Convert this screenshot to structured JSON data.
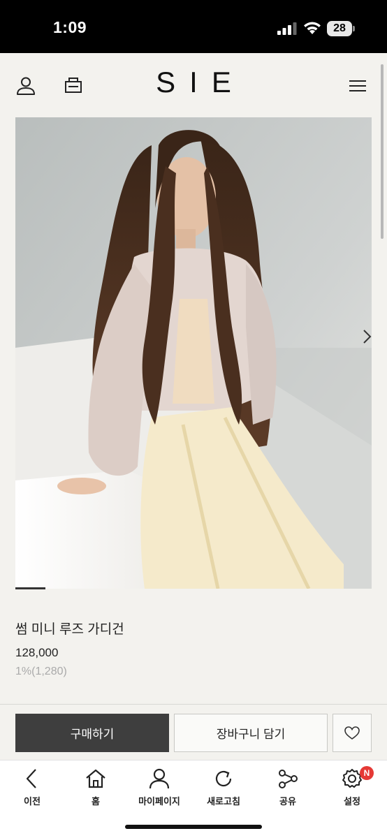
{
  "status_bar": {
    "time": "1:09",
    "battery": "28",
    "icons": [
      "cellular-signal-icon",
      "wifi-icon",
      "battery-icon"
    ]
  },
  "header": {
    "logo": "SIE",
    "icons": [
      "user-icon",
      "shop-icon",
      "menu-icon"
    ]
  },
  "product": {
    "image_alt": "model wearing sheer pink cardigan and cream skirt",
    "image_page": 1,
    "image_count": 12,
    "name": "썸 미니 루즈 가디건",
    "price": "128,000",
    "point": "1%(1,280)"
  },
  "actions": {
    "buy_label": "구매하기",
    "cart_label": "장바구니 담기",
    "wish_icon": "heart-icon"
  },
  "bottom_nav": {
    "items": [
      {
        "label": "이전",
        "icon": "back-arrow-icon"
      },
      {
        "label": "홈",
        "icon": "home-icon"
      },
      {
        "label": "마이페이지",
        "icon": "user-icon"
      },
      {
        "label": "새로고침",
        "icon": "refresh-icon"
      },
      {
        "label": "공유",
        "icon": "share-icon"
      },
      {
        "label": "설정",
        "icon": "settings-icon"
      }
    ],
    "settings_badge": "N"
  },
  "colors": {
    "background": "#f3f2ee",
    "buy_button": "#3e3e3e",
    "badge": "#e53935"
  }
}
